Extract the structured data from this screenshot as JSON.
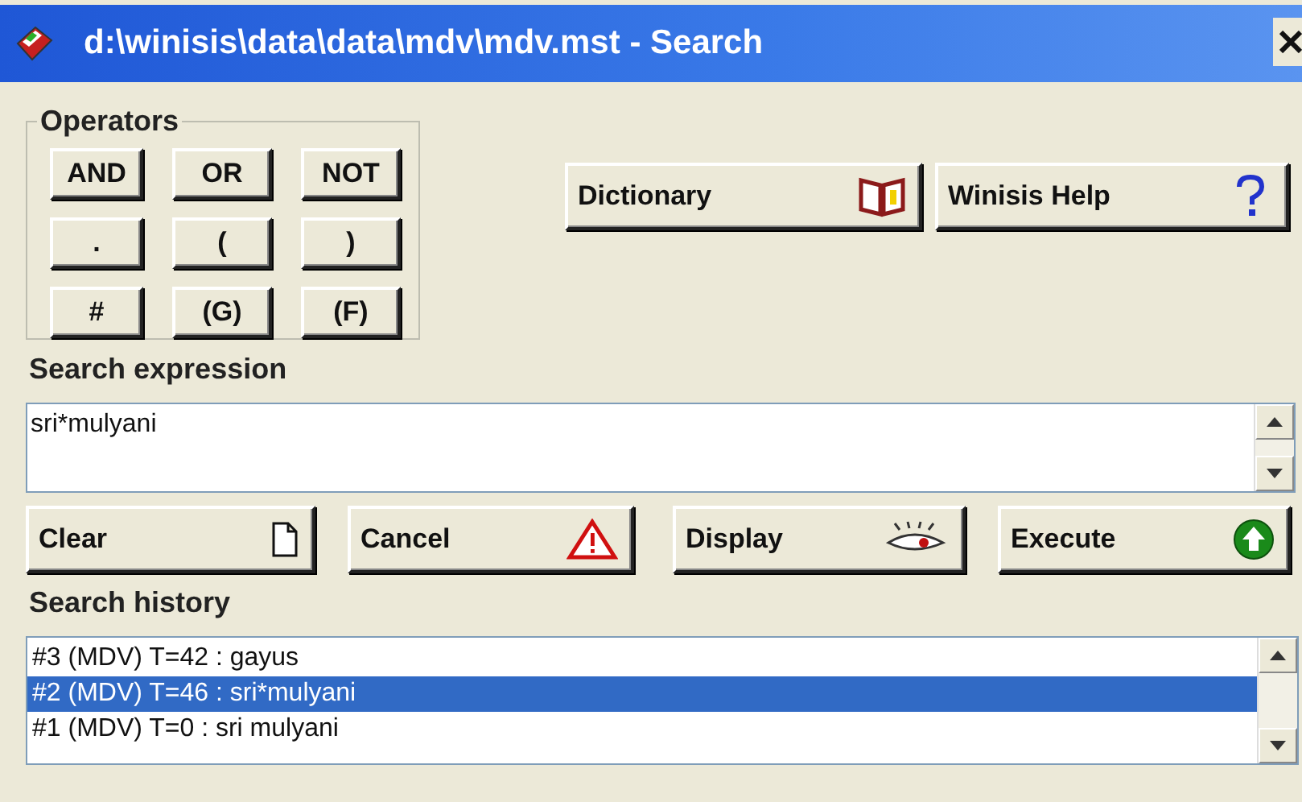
{
  "window": {
    "title": "d:\\winisis\\data\\data\\mdv\\mdv.mst - Search"
  },
  "operators": {
    "title": "Operators",
    "buttons": [
      "AND",
      "OR",
      "NOT",
      ".",
      "(",
      ")",
      "#",
      "(G)",
      "(F)"
    ]
  },
  "top_buttons": [
    {
      "label": "Dictionary",
      "kind": "book"
    },
    {
      "label": "Winisis Help",
      "kind": "help"
    }
  ],
  "search_expression": {
    "label": "Search expression",
    "value": "sri*mulyani"
  },
  "action_buttons": [
    {
      "label": "Clear",
      "kind": "page"
    },
    {
      "label": "Cancel",
      "kind": "warning"
    },
    {
      "label": "Display",
      "kind": "eye"
    },
    {
      "label": "Execute",
      "kind": "go"
    }
  ],
  "search_history": {
    "label": "Search history",
    "items": [
      {
        "text": "#3 (MDV) T=42 : gayus",
        "selected": false
      },
      {
        "text": "#2 (MDV) T=46 : sri*mulyani",
        "selected": true
      },
      {
        "text": "#1 (MDV) T=0 : sri mulyani",
        "selected": false
      }
    ]
  }
}
